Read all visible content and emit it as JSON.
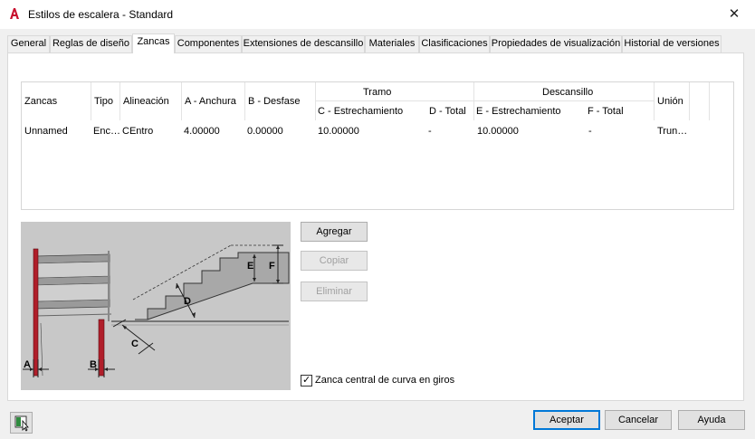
{
  "window": {
    "title": "Estilos de escalera - Standard",
    "close": "✕"
  },
  "tabs": [
    "General",
    "Reglas de diseño",
    "Zancas",
    "Componentes",
    "Extensiones de descansillo",
    "Materiales",
    "Clasificaciones",
    "Propiedades de visualización",
    "Historial de versiones"
  ],
  "grid": {
    "group_tramo": "Tramo",
    "group_descansillo": "Descansillo",
    "headers": {
      "zancas": "Zancas",
      "tipo": "Tipo",
      "alineacion": "Alineación",
      "anchura": "A - Anchura",
      "desfase": "B - Desfase",
      "c_estrech": "C - Estrechamiento",
      "d_total": "D - Total",
      "e_estrech": "E - Estrechamiento",
      "f_total": "F - Total",
      "union": "Unión"
    },
    "row": {
      "zancas": "Unnamed",
      "tipo": "Enc…",
      "alineacion": "CEntro",
      "anchura": "4.00000",
      "desfase": "0.00000",
      "c_estrech": "10.00000",
      "d_total": "-",
      "e_estrech": "10.00000",
      "f_total": "-",
      "union": "Trun…"
    }
  },
  "diagram": {
    "labels": {
      "a": "A",
      "b": "B",
      "c": "C",
      "d": "D",
      "e": "E",
      "f": "F"
    }
  },
  "buttons": {
    "add": "Agregar",
    "copy": "Copiar",
    "delete": "Eliminar"
  },
  "checkbox": {
    "label": "Zanca central de curva en giros",
    "checked": "✓"
  },
  "footer": {
    "accept": "Aceptar",
    "cancel": "Cancelar",
    "help": "Ayuda"
  }
}
